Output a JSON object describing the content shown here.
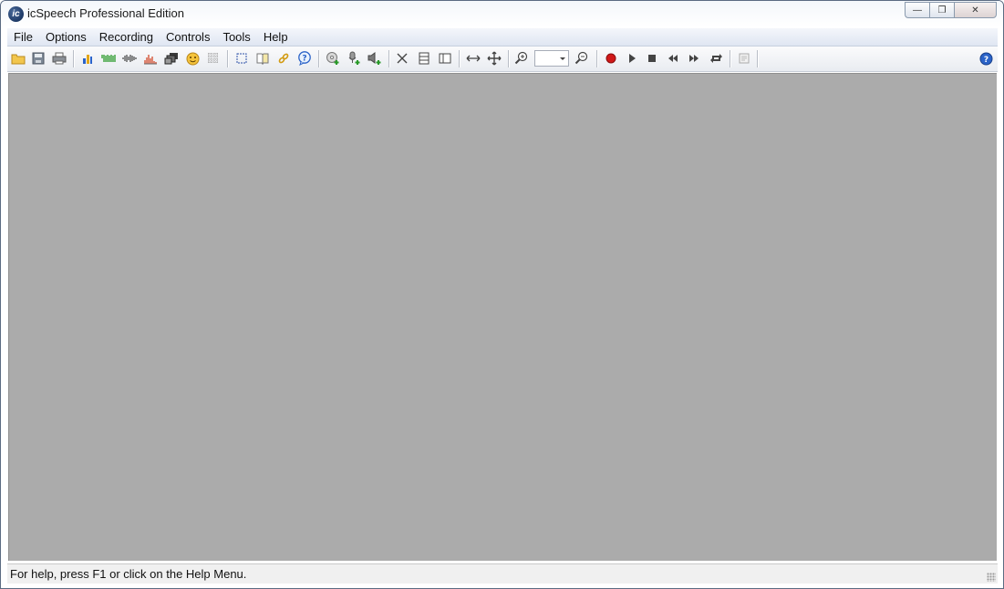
{
  "window": {
    "title": "icSpeech Professional Edition",
    "app_icon_glyph": "ic"
  },
  "caption": {
    "minimize_glyph": "—",
    "maximize_glyph": "❐",
    "close_glyph": "✕"
  },
  "menu": {
    "items": [
      "File",
      "Options",
      "Recording",
      "Controls",
      "Tools",
      "Help"
    ]
  },
  "toolbar": {
    "zoom_value": "",
    "icons": {
      "open": "folder-open-icon",
      "save": "save-icon",
      "print": "print-icon",
      "bar_chart": "bar-chart-icon",
      "waveform": "waveform-icon",
      "pitch": "pitch-icon",
      "spectrum": "spectrum-icon",
      "windows": "windows-icon",
      "smiley": "smiley-icon",
      "grid": "grid-icon",
      "select": "selection-icon",
      "book": "book-icon",
      "link": "link-icon",
      "help_bubble": "help-bubble-icon",
      "record_add": "cd-add-icon",
      "mic_add": "mic-add-icon",
      "speaker_add": "speaker-add-icon",
      "cut": "cut-icon",
      "split_h": "split-horizontal-icon",
      "split_v": "split-vertical-icon",
      "fit_width": "fit-width-icon",
      "move": "move-icon",
      "zoom_in": "zoom-in-icon",
      "zoom_out": "zoom-out-icon",
      "record": "record-icon",
      "play": "play-icon",
      "stop": "stop-icon",
      "rewind": "rewind-icon",
      "fast_forward": "fast-forward-icon",
      "loop": "loop-icon",
      "notes": "notes-icon",
      "help": "help-icon"
    },
    "colors": {
      "record": "#d01818",
      "help": "#2b63c8",
      "waveform": "#2a9a2a",
      "accent_yellow": "#e2a617"
    }
  },
  "statusbar": {
    "text": "For help, press F1 or click on the Help Menu."
  }
}
